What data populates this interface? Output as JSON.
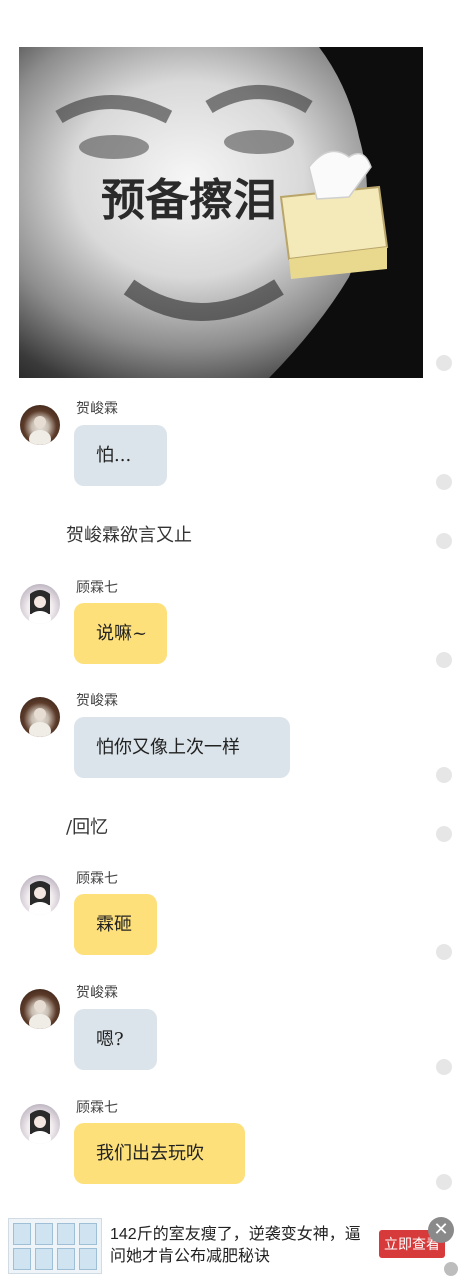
{
  "meme": {
    "caption": "预备擦泪",
    "icon": "tissue-box-icon"
  },
  "messages": [
    {
      "sender": "贺峻霖",
      "text": "怕...",
      "style": "blue"
    },
    {
      "narration": "贺峻霖欲言又止"
    },
    {
      "sender": "顾霖七",
      "text": "说嘛~",
      "style": "yellow"
    },
    {
      "sender": "贺峻霖",
      "text": "怕你又像上次一样",
      "style": "blue"
    },
    {
      "narration": "/回忆"
    },
    {
      "sender": "顾霖七",
      "text": "霖砸",
      "style": "yellow"
    },
    {
      "sender": "贺峻霖",
      "text": "嗯?",
      "style": "blue"
    },
    {
      "sender": "顾霖七",
      "text": "我们出去玩吹",
      "style": "yellow"
    }
  ],
  "ad": {
    "text": "142斤的室友瘦了，逆袭变女神，逼问她才肯公布减肥秘诀",
    "button": "立即查看",
    "close_icon": "close-icon"
  },
  "colors": {
    "bubble_blue": "#dbe4ea",
    "bubble_yellow": "#fde07a",
    "ad_button": "#d73a3a"
  }
}
